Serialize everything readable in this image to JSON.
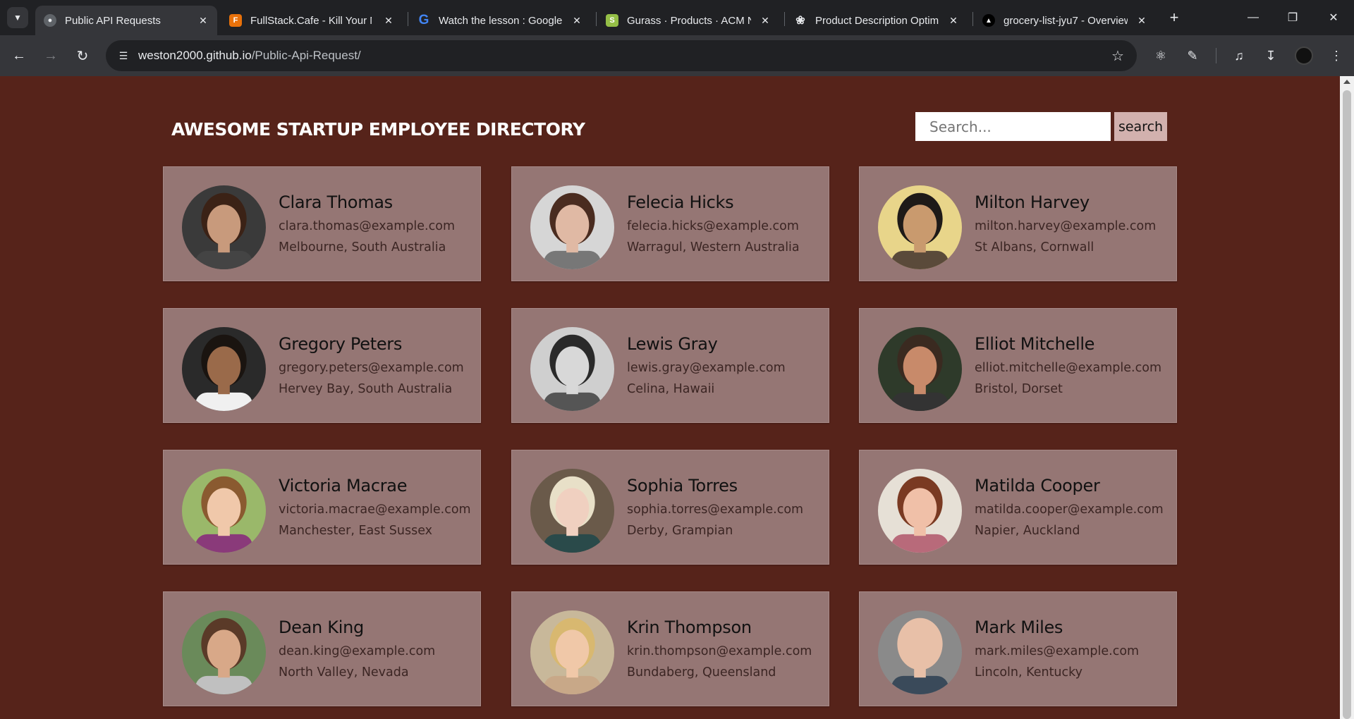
{
  "browser": {
    "tabs": [
      {
        "title": "Public API Requests",
        "active": true,
        "favicon": "globe-icon",
        "favicon_color": "#9aa0a6"
      },
      {
        "title": "FullStack.Cafe - Kill Your Ne",
        "active": false,
        "favicon": "fullstack-cafe-icon",
        "favicon_color": "#e8710a"
      },
      {
        "title": "Watch the lesson : Google",
        "active": false,
        "favicon": "google-icon",
        "favicon_color": "#4285f4"
      },
      {
        "title": "Gurass · Products · ACM Ne",
        "active": false,
        "favicon": "shopify-icon",
        "favicon_color": "#95bf47"
      },
      {
        "title": "Product Description Optim",
        "active": false,
        "favicon": "openai-icon",
        "favicon_color": "#e8eaed"
      },
      {
        "title": "grocery-list-jyu7 - Overview",
        "active": false,
        "favicon": "vercel-icon",
        "favicon_color": "#ffffff"
      }
    ],
    "url_host": "weston2000.github.io",
    "url_path": "/Public-Api-Request/"
  },
  "header": {
    "title": "AWESOME STARTUP EMPLOYEE DIRECTORY",
    "search_placeholder": "Search...",
    "search_button": "search"
  },
  "employees": [
    {
      "name": "Clara Thomas",
      "email": "clara.thomas@example.com",
      "location": "Melbourne, South Australia",
      "bg": "#3a3a3a",
      "skin": "#c89a7c",
      "hair": "#3b2216",
      "shirt": "#444"
    },
    {
      "name": "Felecia Hicks",
      "email": "felecia.hicks@example.com",
      "location": "Warragul, Western Australia",
      "bg": "#d6d6d6",
      "skin": "#e0b9a4",
      "hair": "#4a2c20",
      "shirt": "#777"
    },
    {
      "name": "Milton Harvey",
      "email": "milton.harvey@example.com",
      "location": "St Albans, Cornwall",
      "bg": "#e8d58a",
      "skin": "#c99a6e",
      "hair": "#1e1a18",
      "shirt": "#5a4a3a"
    },
    {
      "name": "Gregory Peters",
      "email": "gregory.peters@example.com",
      "location": "Hervey Bay, South Australia",
      "bg": "#2a2a2a",
      "skin": "#9a6a4a",
      "hair": "#1a1410",
      "shirt": "#f0f0f0"
    },
    {
      "name": "Lewis Gray",
      "email": "lewis.gray@example.com",
      "location": "Celina, Hawaii",
      "bg": "#cfcfcf",
      "skin": "#d8d8d8",
      "hair": "#2a2a2a",
      "shirt": "#555"
    },
    {
      "name": "Elliot Mitchelle",
      "email": "elliot.mitchelle@example.com",
      "location": "Bristol, Dorset",
      "bg": "#2e3a2a",
      "skin": "#c88a6a",
      "hair": "#3a2a20",
      "shirt": "#333"
    },
    {
      "name": "Victoria Macrae",
      "email": "victoria.macrae@example.com",
      "location": "Manchester, East Sussex",
      "bg": "#9ab86a",
      "skin": "#f0c8aa",
      "hair": "#8a5a30",
      "shirt": "#8a3a7a"
    },
    {
      "name": "Sophia Torres",
      "email": "sophia.torres@example.com",
      "location": "Derby, Grampian",
      "bg": "#6a5a4a",
      "skin": "#f0d0c0",
      "hair": "#e8e0c8",
      "shirt": "#2a4a4a"
    },
    {
      "name": "Matilda Cooper",
      "email": "matilda.cooper@example.com",
      "location": "Napier, Auckland",
      "bg": "#e6e0d6",
      "skin": "#f0c0a8",
      "hair": "#7a3a22",
      "shirt": "#b86a7a"
    },
    {
      "name": "Dean King",
      "email": "dean.king@example.com",
      "location": "North Valley, Nevada",
      "bg": "#6a8a5a",
      "skin": "#d8a888",
      "hair": "#5a3a28",
      "shirt": "#c0c0c0"
    },
    {
      "name": "Krin Thompson",
      "email": "krin.thompson@example.com",
      "location": "Bundaberg, Queensland",
      "bg": "#c8b89a",
      "skin": "#f0c8a8",
      "hair": "#d8b870",
      "shirt": "#c8a888"
    },
    {
      "name": "Mark Miles",
      "email": "mark.miles@example.com",
      "location": "Lincoln, Kentucky",
      "bg": "#8a8a8a",
      "skin": "#e8c0a8",
      "hair": "#e8c0a8",
      "shirt": "#3a4a5a"
    }
  ]
}
